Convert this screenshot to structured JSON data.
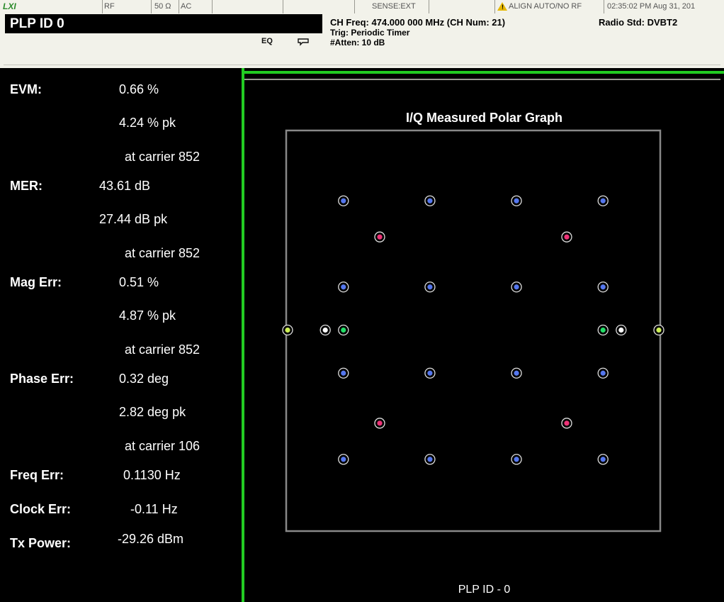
{
  "status_bar": {
    "lxi": "LXI",
    "rf": "RF",
    "impedance": "50 Ω",
    "coupling": "AC",
    "sense": "SENSE:EXT",
    "align": "ALIGN AUTO/NO RF",
    "clock": "02:35:02 PM Aug 31, 201"
  },
  "header": {
    "title": "PLP ID 0",
    "eq": "EQ",
    "ch_freq": "CH Freq: 474.000 000 MHz (CH Num: 21)",
    "radio_std": "Radio Std: DVBT2",
    "trig": "Trig: Periodic Timer",
    "atten": "#Atten: 10 dB"
  },
  "metrics": {
    "evm": {
      "label": "EVM:",
      "rms": "0.66  %",
      "peak": "4.24  % pk",
      "carrier": "at carrier 852"
    },
    "mer": {
      "label": "MER:",
      "rms": "43.61  dB",
      "peak": "27.44  dB pk",
      "carrier": "at carrier 852"
    },
    "mag_err": {
      "label": "Mag Err:",
      "rms": "0.51  %",
      "peak": "4.87  % pk",
      "carrier": "at carrier 852"
    },
    "phase_err": {
      "label": "Phase Err:",
      "rms": "0.32  deg",
      "peak": "2.82  deg pk",
      "carrier": "at carrier 106"
    },
    "freq_err": {
      "label": "Freq Err:",
      "value": "0.1130 Hz"
    },
    "clock_err": {
      "label": "Clock Err:",
      "value": "-0.11 Hz"
    },
    "tx_power": {
      "label": "Tx Power:",
      "value": "-29.26 dBm"
    }
  },
  "plot": {
    "title": "I/Q Measured Polar Graph",
    "footer": "PLP ID - 0"
  },
  "chart_data": {
    "type": "scatter",
    "title": "I/Q Measured Polar Graph",
    "xlim": [
      -1.5,
      1.5
    ],
    "ylim": [
      -1.5,
      1.5
    ],
    "grid": false,
    "series": [
      {
        "color": "#5577ee",
        "points": [
          [
            -0.93,
            0.93
          ],
          [
            -0.31,
            0.93
          ],
          [
            0.31,
            0.93
          ],
          [
            0.93,
            0.93
          ],
          [
            -0.93,
            0.31
          ],
          [
            -0.31,
            0.31
          ],
          [
            0.31,
            0.31
          ],
          [
            0.93,
            0.31
          ],
          [
            -0.93,
            -0.31
          ],
          [
            -0.31,
            -0.31
          ],
          [
            0.31,
            -0.31
          ],
          [
            0.93,
            -0.31
          ],
          [
            -0.93,
            -0.93
          ],
          [
            -0.31,
            -0.93
          ],
          [
            0.31,
            -0.93
          ],
          [
            0.93,
            -0.93
          ]
        ]
      },
      {
        "color": "#ee3377",
        "points": [
          [
            -0.67,
            0.67
          ],
          [
            0.67,
            0.67
          ],
          [
            -0.67,
            -0.67
          ],
          [
            0.67,
            -0.67
          ]
        ]
      },
      {
        "color": "#22dd66",
        "points": [
          [
            -0.93,
            0.0
          ],
          [
            0.93,
            0.0
          ]
        ]
      },
      {
        "color": "#ffffff",
        "points": [
          [
            -1.06,
            0.0
          ],
          [
            1.06,
            0.0
          ]
        ]
      },
      {
        "color": "#ccee55",
        "points": [
          [
            -1.33,
            0.0
          ],
          [
            1.33,
            0.0
          ]
        ]
      }
    ]
  }
}
